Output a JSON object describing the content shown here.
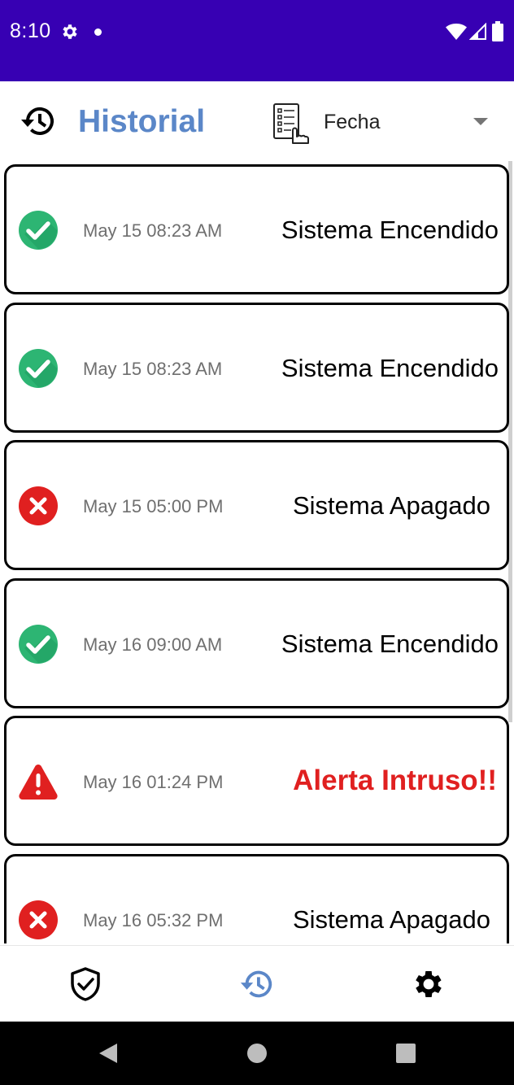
{
  "status_bar": {
    "time": "8:10",
    "background_color": "#3700B3",
    "icons": [
      "gear-icon",
      "notification-dot-icon",
      "wifi-icon",
      "signal-icon",
      "battery-icon"
    ]
  },
  "header": {
    "title": "Historial",
    "title_color": "#5B87C8",
    "filter": {
      "selected": "Fecha"
    }
  },
  "events": [
    {
      "status": "on",
      "time": "May 15 08:23 AM",
      "message": "Sistema Encendido"
    },
    {
      "status": "on",
      "time": "May 15 08:23 AM",
      "message": "Sistema Encendido"
    },
    {
      "status": "off",
      "time": "May 15 05:00 PM",
      "message": "Sistema Apagado"
    },
    {
      "status": "on",
      "time": "May 16 09:00 AM",
      "message": "Sistema Encendido"
    },
    {
      "status": "alert",
      "time": "May 16 01:24 PM",
      "message": "Alerta Intruso!!"
    },
    {
      "status": "off",
      "time": "May 16 05:32 PM",
      "message": "Sistema Apagado"
    }
  ],
  "colors": {
    "check_green": "#2DB573",
    "error_red": "#E02020",
    "alert_text": "#E02020",
    "nav_active": "#5B87C8"
  },
  "bottom_nav": {
    "items": [
      {
        "icon": "shield-check-icon",
        "active": false
      },
      {
        "icon": "history-icon",
        "active": true
      },
      {
        "icon": "gear-icon",
        "active": false
      }
    ]
  },
  "system_nav": {
    "items": [
      "back-icon",
      "home-icon",
      "recents-icon"
    ]
  }
}
